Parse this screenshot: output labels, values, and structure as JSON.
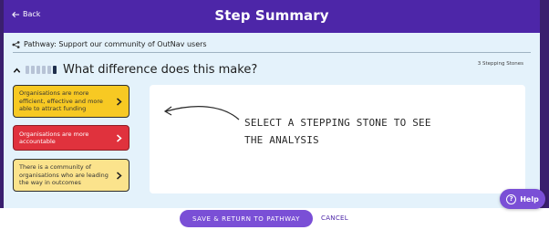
{
  "header": {
    "back_label": "Back",
    "title": "Step Summary"
  },
  "pathway": {
    "label": "Pathway: Support our community of OutNav users",
    "icon": "share-nodes-icon"
  },
  "section": {
    "title": "What difference does this make?",
    "stepping_stones_count": "3 Stepping Stones",
    "progress_stones": 6,
    "active_stone": 6
  },
  "stepping_stones": [
    {
      "label": "Organisations are more efficient, effective and more able to attract funding",
      "color": "#f7c923"
    },
    {
      "label": "Organisations are more accountable",
      "color": "#e0323d"
    },
    {
      "label": "There is a community of organisations who are leading the way in outcomes",
      "color": "#fbe38c"
    }
  ],
  "analysis_panel": {
    "hint": "SELECT A STEPPING STONE TO SEE THE ANALYSIS"
  },
  "footer": {
    "save_label": "SAVE & RETURN TO PATHWAY",
    "cancel_label": "CANCEL"
  },
  "help": {
    "label": "Help"
  },
  "colors": {
    "header_bg": "#4d26a8",
    "accent_button": "#7a4fd6",
    "content_bg": "#e4f2fb"
  }
}
